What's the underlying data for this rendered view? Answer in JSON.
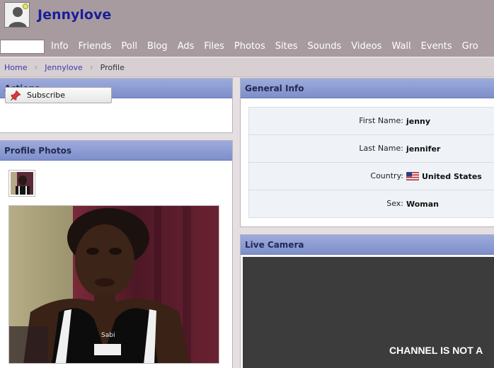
{
  "header": {
    "title": "Jennylove",
    "avatar_icon": "user-avatar-icon"
  },
  "nav": {
    "items": [
      "Info",
      "Friends",
      "Poll",
      "Blog",
      "Ads",
      "Files",
      "Photos",
      "Sites",
      "Sounds",
      "Videos",
      "Wall",
      "Events",
      "Gro"
    ]
  },
  "breadcrumb": {
    "home": "Home",
    "profile": "Jennylove",
    "current": "Profile"
  },
  "actions": {
    "title": "Actions",
    "subscribe": "Subscribe"
  },
  "photos": {
    "title": "Profile Photos"
  },
  "general_info": {
    "title": "General Info",
    "rows": [
      {
        "label": "First Name:",
        "value": "jenny"
      },
      {
        "label": "Last Name:",
        "value": "jennifer"
      },
      {
        "label": "Country:",
        "value": "United States"
      },
      {
        "label": "Sex:",
        "value": "Woman"
      }
    ]
  },
  "camera": {
    "title": "Live Camera",
    "message": "CHANNEL IS NOT A"
  },
  "colors": {
    "header_bg": "#a89b9f",
    "title_blue": "#1a1e9a",
    "block_head": "#8d9cd4"
  }
}
